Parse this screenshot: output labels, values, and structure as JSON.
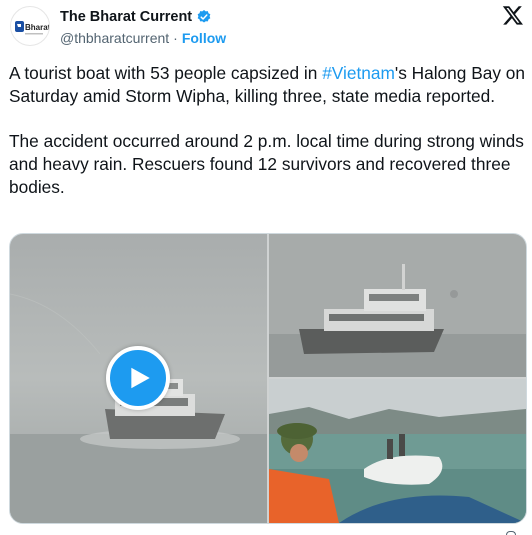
{
  "author": {
    "name": "The Bharat Current",
    "handle": "@thbharatcurrent",
    "separator": "·",
    "follow_label": "Follow",
    "avatar_text": "Bharat",
    "avatar_icon": "bharat-current-logo",
    "verified_icon": "verified-badge-icon",
    "brand_icon": "x-logo-icon"
  },
  "post": {
    "text_before_hashtag": "A tourist boat with 53 people capsized in ",
    "hashtag": "#Vietnam",
    "text_after_hashtag": "'s Halong Bay on Saturday amid Storm Wipha, killing three, state media reported.\n\nThe accident occurred around 2 p.m. local time during strong winds and heavy rain. Rescuers found 12 survivors and recovered three bodies."
  },
  "media": {
    "video_icon": "play-icon",
    "images": [
      "boat-in-storm-video-thumbnail",
      "boat-in-storm-photo",
      "capsized-boat-rescue-photo"
    ]
  },
  "colors": {
    "accent": "#1d9bf0",
    "text": "#0f1419",
    "secondary": "#536471"
  }
}
